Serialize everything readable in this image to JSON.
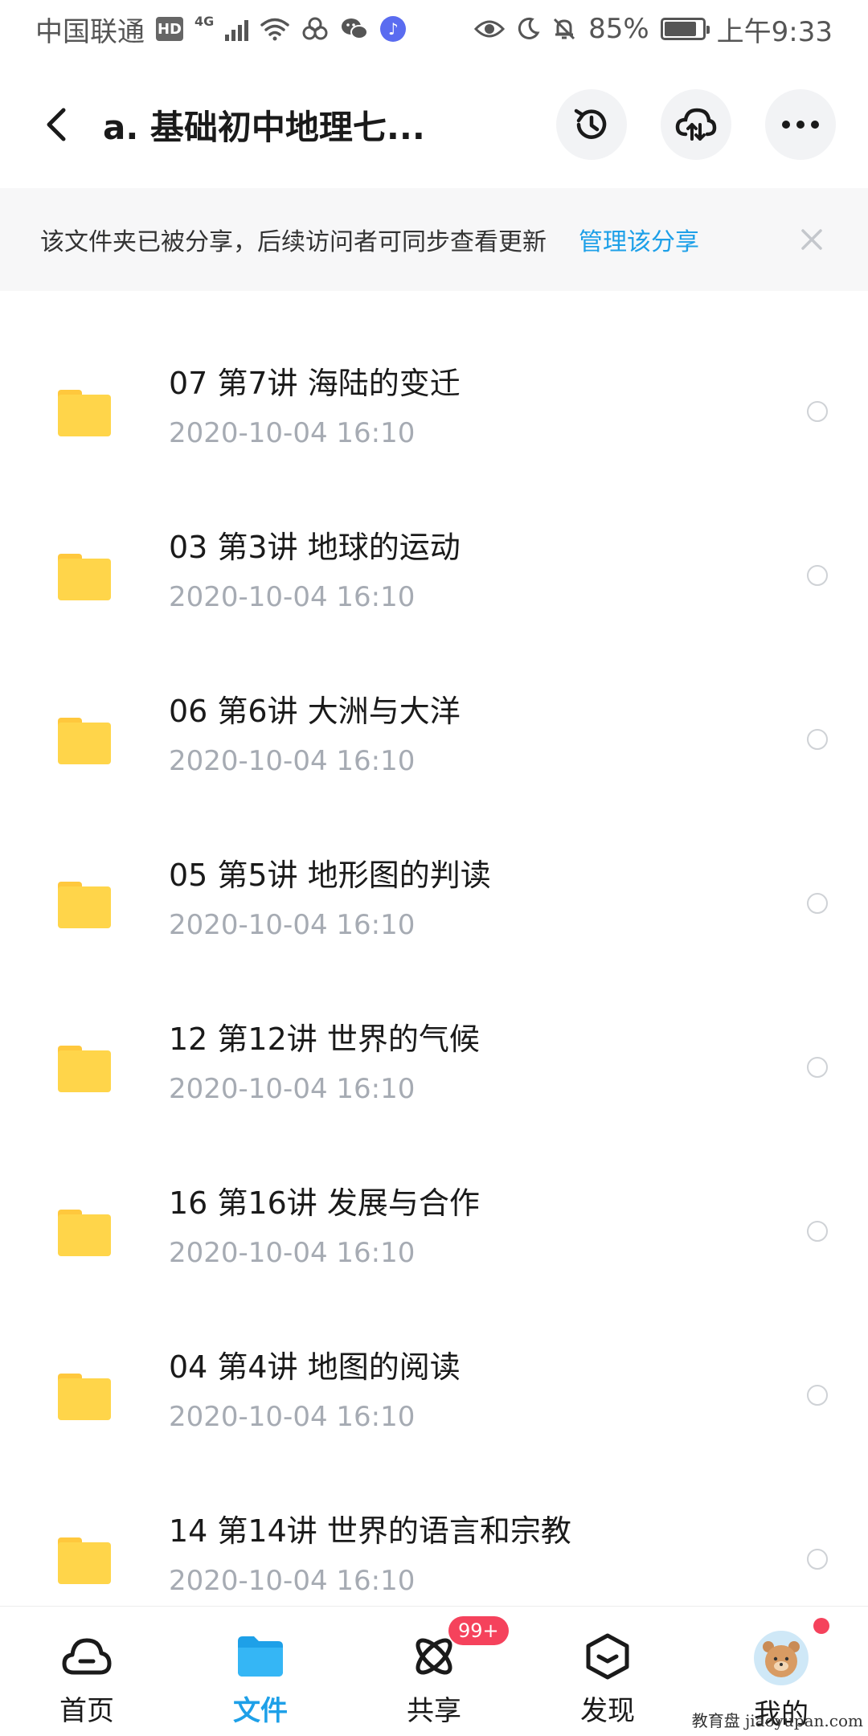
{
  "status_bar": {
    "carrier": "中国联通",
    "hd_label": "HD",
    "network": "4G",
    "battery_percent": "85%",
    "battery_level": 0.85,
    "time": "上午9:33",
    "icons": [
      "signal-icon",
      "wifi-icon",
      "link-icon",
      "wechat-icon",
      "music-icon",
      "eye-icon",
      "moon-icon",
      "bell-off-icon",
      "battery-icon"
    ]
  },
  "header": {
    "title": "a. 基础初中地理七...",
    "icons": [
      "back-icon",
      "history-icon",
      "cloud-sync-icon",
      "more-icon"
    ]
  },
  "share_notice": {
    "text": "该文件夹已被分享，后续访问者可同步查看更新",
    "link": "管理该分享"
  },
  "files": [
    {
      "name": "07 第7讲 海陆的变迁",
      "date": "2020-10-04  16:10"
    },
    {
      "name": "03 第3讲 地球的运动",
      "date": "2020-10-04  16:10"
    },
    {
      "name": "06 第6讲 大洲与大洋",
      "date": "2020-10-04  16:10"
    },
    {
      "name": "05 第5讲 地形图的判读",
      "date": "2020-10-04  16:10"
    },
    {
      "name": "12 第12讲 世界的气候",
      "date": "2020-10-04  16:10"
    },
    {
      "name": "16 第16讲 发展与合作",
      "date": "2020-10-04  16:10"
    },
    {
      "name": "04 第4讲 地图的阅读",
      "date": "2020-10-04  16:10"
    },
    {
      "name": "14 第14讲 世界的语言和宗教",
      "date": "2020-10-04  16:10"
    }
  ],
  "nav": {
    "home": "首页",
    "files": "文件",
    "share": "共享",
    "share_badge": "99+",
    "discover": "发现",
    "mine": "我的"
  },
  "colors": {
    "accent": "#1ea0e8",
    "folder": "#ffd54a",
    "badge": "#f5425c"
  },
  "watermark": "教育盘 jiaoyupan.com"
}
